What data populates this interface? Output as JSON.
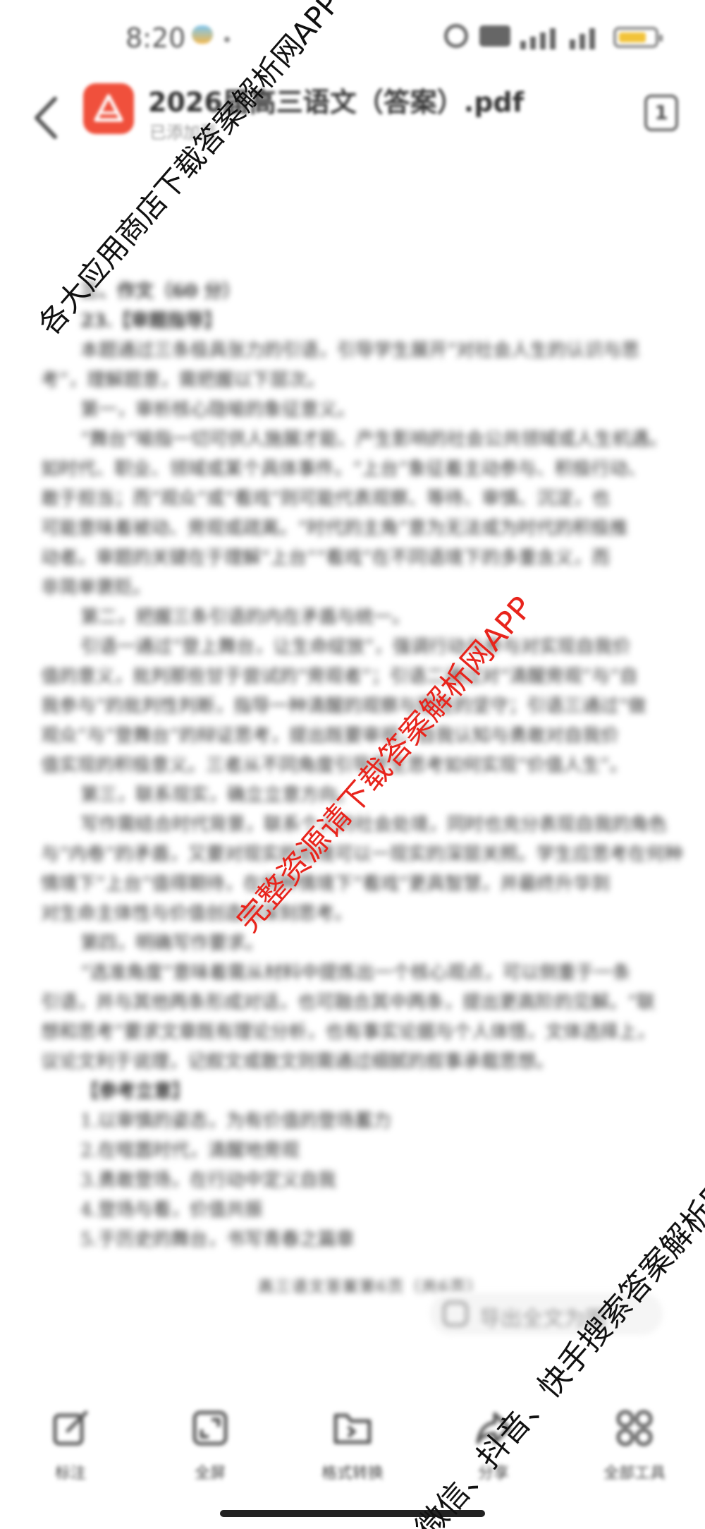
{
  "status_bar": {
    "time": "8:20"
  },
  "header": {
    "title": "2026届高三语文（答案）.pdf",
    "subtitle": "已添加至",
    "page_count": "1"
  },
  "document": {
    "lines": [
      {
        "style": "h",
        "text": "三、作文（60 分）"
      },
      {
        "style": "h",
        "text": "23.【审题指导】"
      },
      {
        "style": "ind",
        "text": "本题通过三条极具张力的引语，引导学生展开“对社会人生的认识与思"
      },
      {
        "style": "",
        "text": "考”，理解题意，需把握以下层次。"
      },
      {
        "style": "ind",
        "text": "第一，审析核心隐喻的象征意义。"
      },
      {
        "style": "ind",
        "text": "“舞台”喻指一切可供人施展才能、产生影响的社会公共领域或人生机遇。"
      },
      {
        "style": "",
        "text": "如时代、职业、领域或某个具体事件。“上台”象征着主动参与、积极行动、"
      },
      {
        "style": "",
        "text": "敢于担当；而“观众”或“看戏”则可能代表观察、等待、审慎、沉淀，也"
      },
      {
        "style": "",
        "text": "可能意味着被动、旁观或疏离。“时代的主角”意为无法或为时代的积极推"
      },
      {
        "style": "",
        "text": "动者。审题的关键在于理解“上台”“看戏”在不同语境下的多重含义，而"
      },
      {
        "style": "",
        "text": "非简单褒贬。"
      },
      {
        "style": "ind",
        "text": "第二，把握三条引语的内在矛盾与统一。"
      },
      {
        "style": "ind",
        "text": "引语一通过“登上舞台，让生命绽放”，强调行动与参与对实现自我价"
      },
      {
        "style": "",
        "text": "值的意义，批判那些甘于尝试的“旁观者”；引语二通过对“清醒旁观”与“自"
      },
      {
        "style": "",
        "text": "我参与”的批判性判断，指导一种清醒的观察与理性的坚守；引语三通过“做"
      },
      {
        "style": "",
        "text": "观众”与“登舞台”的辩证思考，提出既要审视，自我认知与勇敢对自我价"
      },
      {
        "style": "",
        "text": "值实现的积极意义。三者从不同角度引导学生思考如何实现“价值人生”。"
      },
      {
        "style": "ind",
        "text": "第三，联系现实，确立立意方向。"
      },
      {
        "style": "ind",
        "text": "写作需结合时代背景，联系个人的社会处境，同时也充分表现自我的角色"
      },
      {
        "style": "",
        "text": "与“内卷”的矛盾，又要对现实的处境可以一现实的深层关照。学生应思考在何种"
      },
      {
        "style": "",
        "text": "情境下“上台”值得期待，在何种情境下“看戏”更具智慧，并最终升华到"
      },
      {
        "style": "",
        "text": "对生命主体性与价值创造的深刻思考。"
      },
      {
        "style": "ind",
        "text": "第四，明确写作要求。"
      },
      {
        "style": "ind",
        "text": "“选准角度”意味着需从材料中提炼出一个核心观点，可以侧重于一条"
      },
      {
        "style": "",
        "text": "引语，并与其他两条形成对话，也可融合其中两条，提出更高阶的见解。“联"
      },
      {
        "style": "",
        "text": "想和思考”要求文章既有理论分析，也有事实论据与个人体悟，文体选择上，"
      },
      {
        "style": "",
        "text": "议论文利于说理，记叙文或散文则需通过细腻的叙事承载思想。"
      },
      {
        "style": "h",
        "text": "【参考立意】"
      },
      {
        "style": "item",
        "text": "1.以审慎的姿态，为有价值的登场蓄力"
      },
      {
        "style": "item",
        "text": "2.在喧嚣时代，清醒地旁观"
      },
      {
        "style": "item",
        "text": "3.勇敢登场，在行动中定义自我"
      },
      {
        "style": "item",
        "text": "4.登场与看，价值共振"
      },
      {
        "style": "item",
        "text": "5.于历史的舞台，书写青春之篇章"
      }
    ],
    "footer": "高三语文答案第6页（共6页）"
  },
  "export_button": {
    "label": "导出全文为图"
  },
  "toolbar": {
    "items": [
      {
        "label": "标注",
        "icon": "edit-icon"
      },
      {
        "label": "全屏",
        "icon": "fullscreen-icon"
      },
      {
        "label": "格式转换",
        "icon": "folder-convert-icon"
      },
      {
        "label": "分享",
        "icon": "share-icon"
      },
      {
        "label": "全部工具",
        "icon": "grid-tools-icon"
      }
    ]
  },
  "watermarks": {
    "top": "各大应用商店下载答案解析网APP",
    "middle": "完整资源请下载答案解析网APP",
    "bottom": "微信、抖音、快手搜索答案解析网"
  },
  "colors": {
    "logo": "#f0503c",
    "watermark_red": "#e8241c",
    "battery": "#f2c33a"
  }
}
